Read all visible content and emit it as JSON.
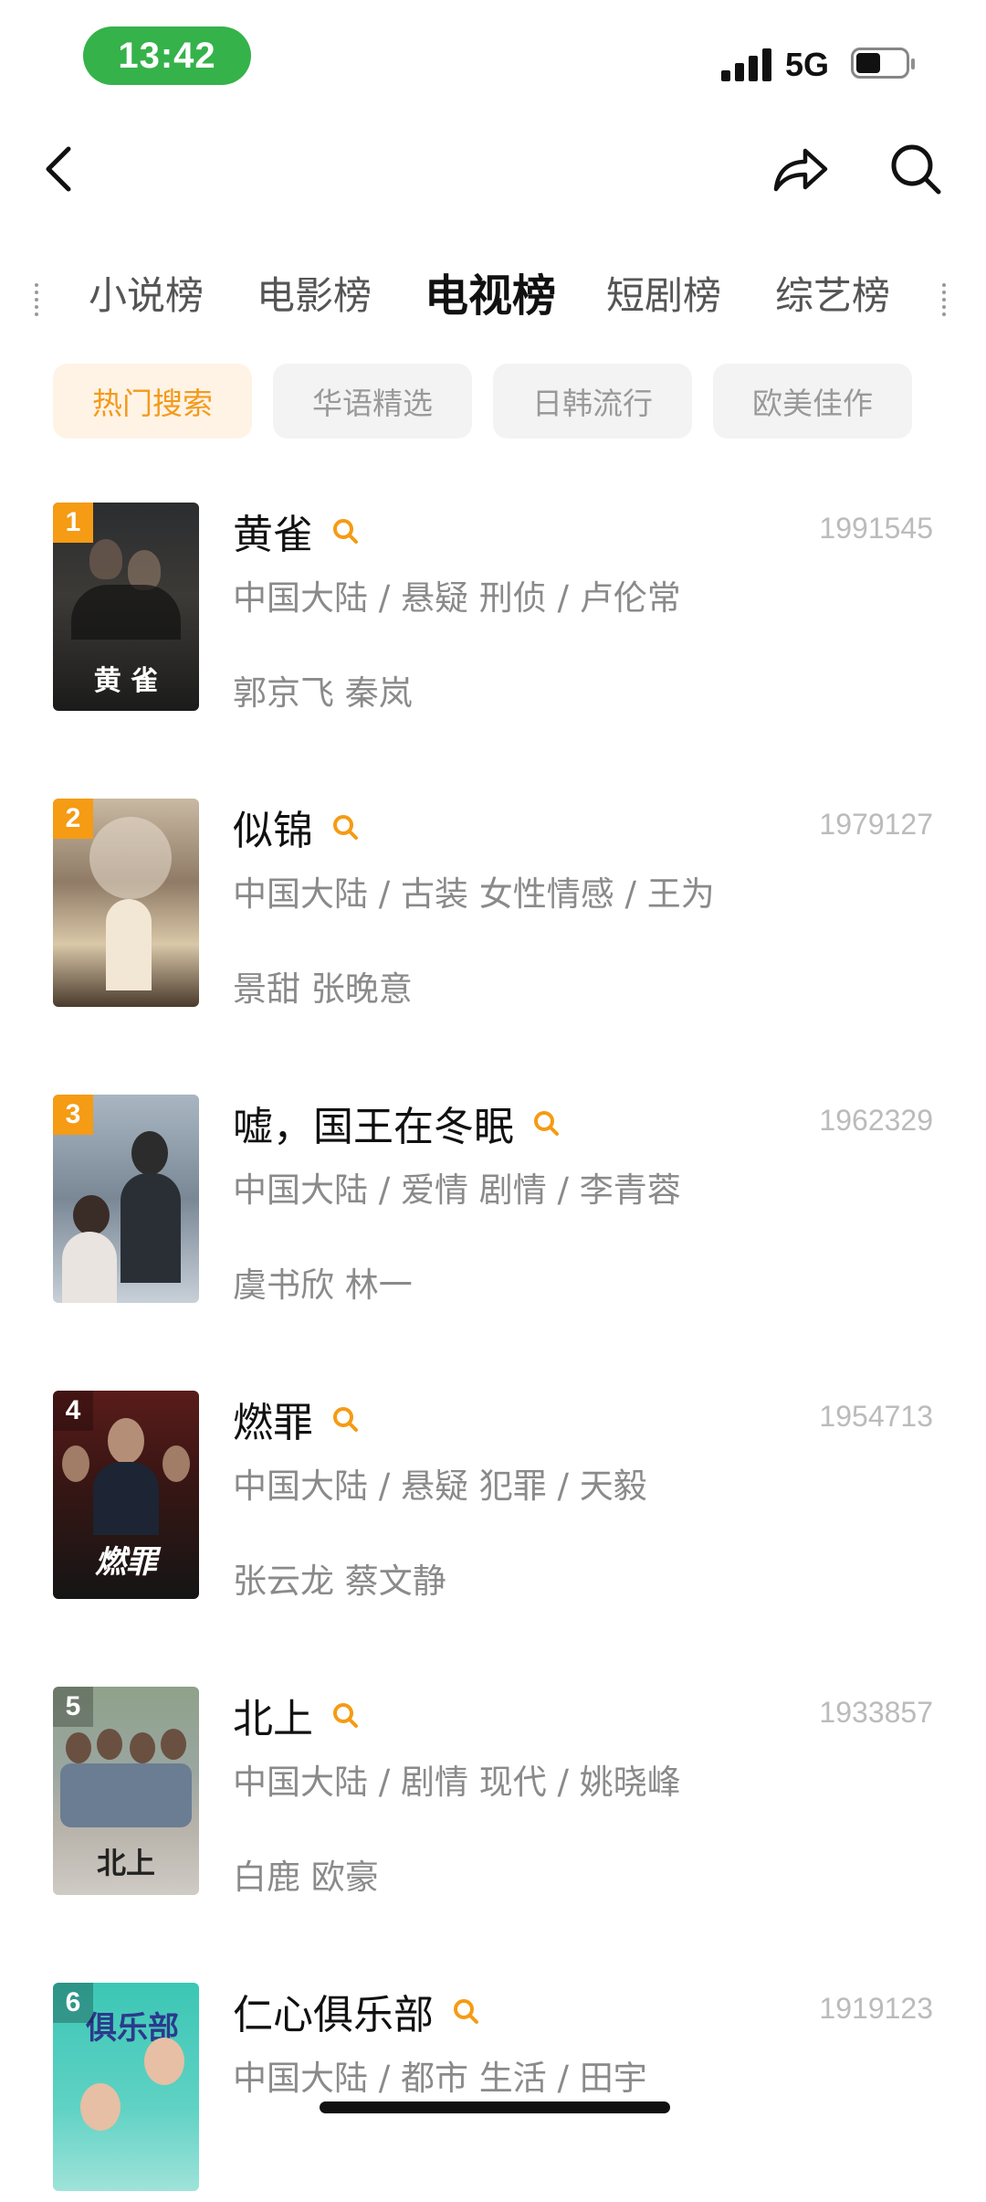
{
  "status_bar": {
    "time": "13:42",
    "network": "5G"
  },
  "nav": {
    "back_icon": "chevron-left-icon",
    "share_icon": "share-icon",
    "search_icon": "search-icon"
  },
  "tabs": [
    {
      "label": "小说榜"
    },
    {
      "label": "电影榜"
    },
    {
      "label": "电视榜",
      "active": true
    },
    {
      "label": "短剧榜"
    },
    {
      "label": "综艺榜"
    }
  ],
  "chips": [
    {
      "label": "热门搜索",
      "active": true
    },
    {
      "label": "华语精选"
    },
    {
      "label": "日韩流行"
    },
    {
      "label": "欧美佳作"
    }
  ],
  "items": [
    {
      "rank": "1",
      "title": "黄雀",
      "score": "1991545",
      "meta": "中国大陆 / 悬疑 刑侦 / 卢伦常",
      "cast": "郭京飞 秦岚",
      "poster_text": "黄 雀"
    },
    {
      "rank": "2",
      "title": "似锦",
      "score": "1979127",
      "meta": "中国大陆 / 古装 女性情感 / 王为",
      "cast": "景甜 张晚意",
      "poster_text": ""
    },
    {
      "rank": "3",
      "title": "嘘，国王在冬眠",
      "score": "1962329",
      "meta": "中国大陆 / 爱情 剧情 / 李青蓉",
      "cast": "虞书欣 林一",
      "poster_text": ""
    },
    {
      "rank": "4",
      "title": "燃罪",
      "score": "1954713",
      "meta": "中国大陆 / 悬疑 犯罪 / 天毅",
      "cast": "张云龙 蔡文静",
      "poster_text": "燃罪"
    },
    {
      "rank": "5",
      "title": "北上",
      "score": "1933857",
      "meta": "中国大陆 / 剧情 现代 / 姚晓峰",
      "cast": "白鹿 欧豪",
      "poster_text": "北上"
    },
    {
      "rank": "6",
      "title": "仁心俱乐部",
      "score": "1919123",
      "meta": "中国大陆 / 都市 生活 / 田宇",
      "cast": "",
      "poster_text": "俱乐部"
    }
  ],
  "colors": {
    "accent": "#f59b14",
    "time_pill": "#35b24a"
  }
}
